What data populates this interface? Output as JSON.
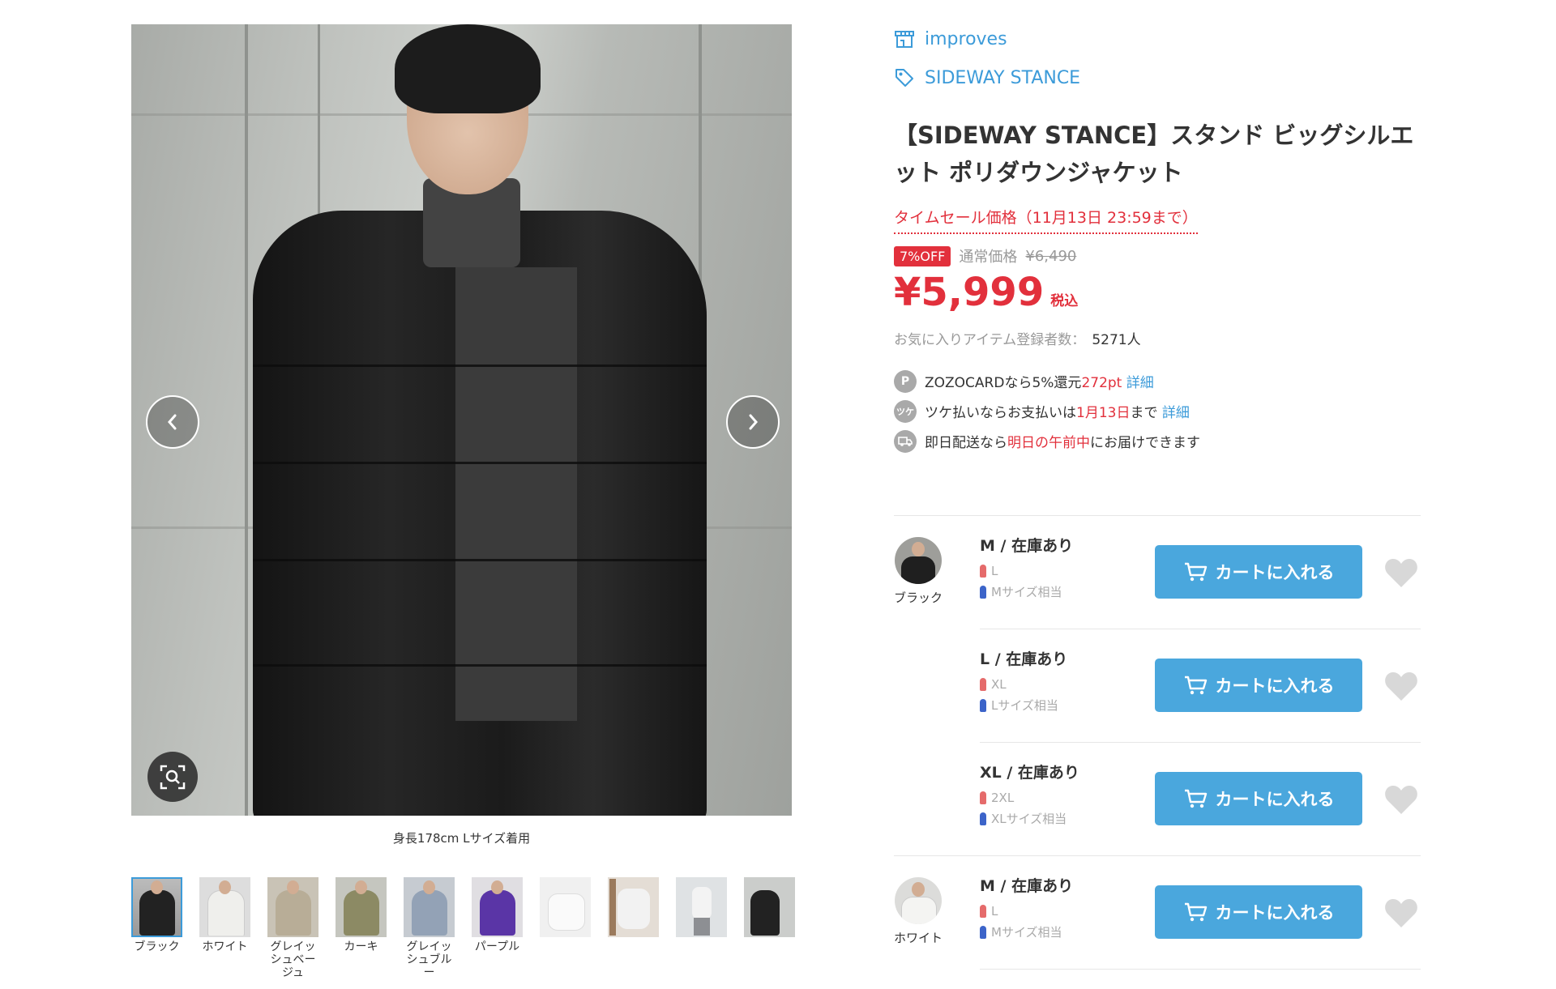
{
  "shop": {
    "name": "improves",
    "brand": "SIDEWAY STANCE"
  },
  "product": {
    "title": "【SIDEWAY STANCE】スタンド ビッグシルエット ポリダウンジャケット",
    "sale_label": "タイムセール価格（11月13日 23:59まで）",
    "discount_badge": "7%OFF",
    "regular_label": "通常価格",
    "regular_price": "¥6,490",
    "price": "¥5,999",
    "tax_label": "税込",
    "favorites_label": "お気に入りアイテム登録者数：",
    "favorites_count": "5271人"
  },
  "gallery": {
    "caption": "身長178cm Lサイズ着用",
    "thumbnails": [
      {
        "label": "ブラック",
        "selected": true
      },
      {
        "label": "ホワイト"
      },
      {
        "label": "グレイッシュベージュ"
      },
      {
        "label": "カーキ"
      },
      {
        "label": "グレイッシュブルー"
      },
      {
        "label": "パープル"
      },
      {
        "label": ""
      },
      {
        "label": ""
      },
      {
        "label": ""
      },
      {
        "label": ""
      }
    ]
  },
  "benefits": {
    "zozocard": {
      "icon": "P",
      "text1": "ZOZOCARDなら5%還元",
      "points": "272pt",
      "link": "詳細"
    },
    "tsuke": {
      "icon": "ツケ",
      "text1": "ツケ払いならお支払いは",
      "date": "1月13日",
      "text2": "まで",
      "link": "詳細"
    },
    "delivery": {
      "text1": "即日配送なら",
      "highlight": "明日の午前中",
      "text2": "にお届けできます"
    }
  },
  "cart_label": "カートに入れる",
  "skus": [
    {
      "color": "ブラック",
      "size": "M / 在庫あり",
      "women": "L",
      "men": "Mサイズ相当"
    },
    {
      "size": "L / 在庫あり",
      "women": "XL",
      "men": "Lサイズ相当"
    },
    {
      "size": "XL / 在庫あり",
      "women": "2XL",
      "men": "XLサイズ相当"
    },
    {
      "color": "ホワイト",
      "size": "M / 在庫あり",
      "women": "L",
      "men": "Mサイズ相当"
    }
  ],
  "colors": {
    "accent": "#3c9bd9",
    "sale": "#e2303c",
    "cart_button": "#4aa7dd"
  }
}
